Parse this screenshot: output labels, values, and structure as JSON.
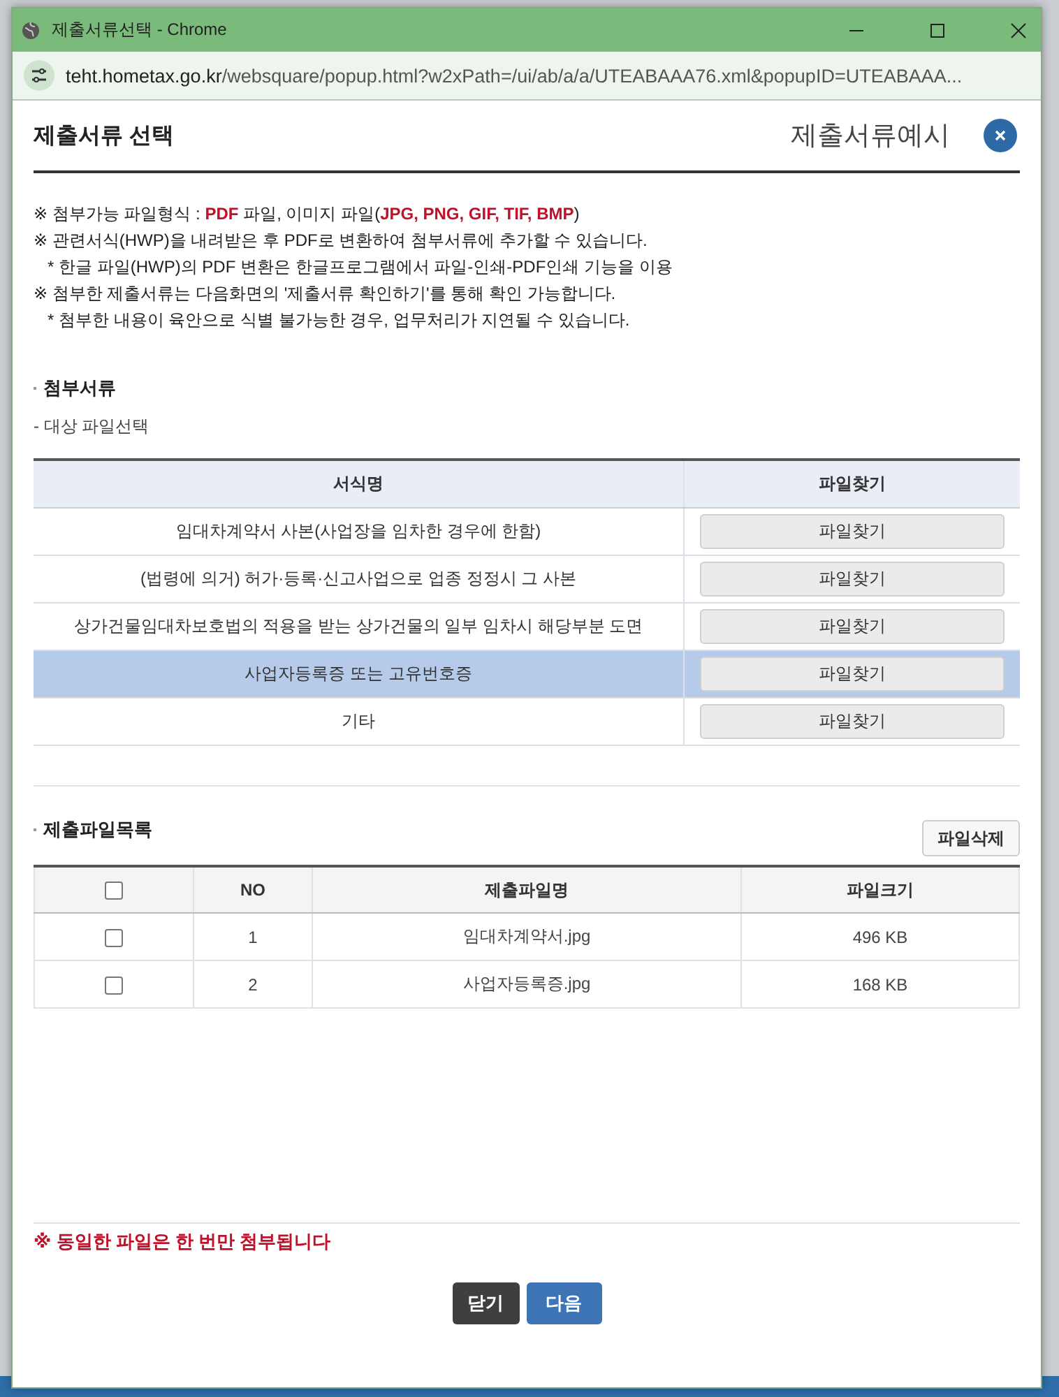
{
  "window": {
    "title": "제출서류선택 - Chrome",
    "url_host": "teht.hometax.go.kr",
    "url_path": "/websquare/popup.html?w2xPath=/ui/ab/a/a/UTEABAAA76.xml&popupID=UTEABAAA..."
  },
  "header": {
    "title": "제출서류 선택",
    "example_link": "제출서류예시"
  },
  "notices": [
    {
      "indent": false,
      "text": "※ 첨부가능 파일형식 : **PDF** 파일, 이미지 파일(**JPG, PNG, GIF, TIF, BMP**)"
    },
    {
      "indent": false,
      "text": "※ 관련서식(HWP)을 내려받은 후 PDF로 변환하여 첨부서류에 추가할 수 있습니다."
    },
    {
      "indent": true,
      "text": "* 한글 파일(HWP)의 PDF 변환은 한글프로그램에서 파일-인쇄-PDF인쇄 기능을 이용"
    },
    {
      "indent": false,
      "text": "※ 첨부한 제출서류는 다음화면의 '제출서류 확인하기'를 통해 확인 가능합니다."
    },
    {
      "indent": true,
      "text": "* 첨부한 내용이 육안으로 식별 불가능한 경우, 업무처리가 지연될 수 있습니다."
    }
  ],
  "attach_section": {
    "title": "첨부서류",
    "subtitle": "- 대상 파일선택",
    "columns": [
      "서식명",
      "파일찾기"
    ],
    "rows": [
      {
        "name": "임대차계약서 사본(사업장을 임차한 경우에 한함)",
        "button": "파일찾기",
        "selected": false
      },
      {
        "name": "(법령에 의거) 허가·등록·신고사업으로 업종 정정시 그 사본",
        "button": "파일찾기",
        "selected": false
      },
      {
        "name": "상가건물임대차보호법의 적용을 받는 상가건물의 일부 임차시 해당부분 도면",
        "button": "파일찾기",
        "selected": false
      },
      {
        "name": "사업자등록증 또는 고유번호증",
        "button": "파일찾기",
        "selected": true
      },
      {
        "name": "기타",
        "button": "파일찾기",
        "selected": false
      }
    ]
  },
  "file_section": {
    "title": "제출파일목록",
    "delete_button": "파일삭제",
    "select_all_checked": false,
    "columns": [
      "NO",
      "제출파일명",
      "파일크기"
    ],
    "rows": [
      {
        "checked": false,
        "no": "1",
        "name": "임대차계약서.jpg",
        "size": "496 KB"
      },
      {
        "checked": false,
        "no": "2",
        "name": "사업자등록증.jpg",
        "size": "168 KB"
      }
    ]
  },
  "warning": "※ 동일한 파일은 한 번만 첨부됩니다",
  "buttons": [
    {
      "kind": "dark",
      "label": "닫기"
    },
    {
      "kind": "primary",
      "label": "다음"
    }
  ]
}
